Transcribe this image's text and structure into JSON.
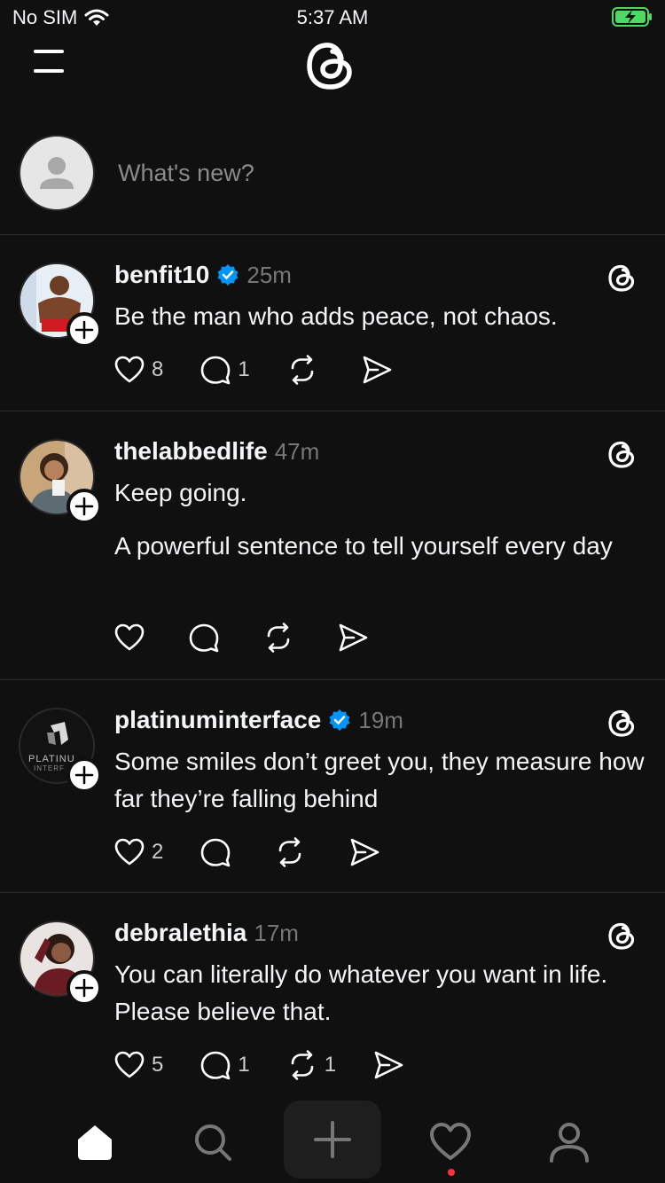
{
  "status_bar": {
    "carrier": "No SIM",
    "time": "5:37 AM",
    "battery_color": "#4cd964"
  },
  "composer": {
    "placeholder": "What's new?"
  },
  "colors": {
    "verified": "#0095f6",
    "notification_dot": "#ff3040",
    "accent_text": "#f3f5f7",
    "muted": "#777777"
  },
  "posts": [
    {
      "username": "benfit10",
      "verified": true,
      "time": "25m",
      "text": "Be the man who adds peace, not chaos.",
      "likes": "8",
      "replies": "1",
      "reposts": "",
      "avatar_icon": "person-photo"
    },
    {
      "username": "thelabbedlife",
      "verified": false,
      "time": "47m",
      "text": "Keep going.",
      "text2": "A powerful sentence to tell yourself every day",
      "likes": "",
      "replies": "",
      "reposts": "",
      "avatar_icon": "person-photo"
    },
    {
      "username": "platinuminterface",
      "verified": true,
      "time": "19m",
      "text": "Some smiles don’t greet you, they measure how far they’re falling behind",
      "likes": "2",
      "replies": "",
      "reposts": "",
      "avatar_icon": "platinum-logo",
      "avatar_text": "PLATINU",
      "avatar_text2": "INTERF"
    },
    {
      "username": "debralethia",
      "verified": false,
      "time": "17m",
      "text": "You can literally do whatever you want in life. Please believe that.",
      "likes": "5",
      "replies": "1",
      "reposts": "1",
      "avatar_icon": "person-photo"
    }
  ],
  "tabs": [
    "home-icon",
    "search-icon",
    "create-icon",
    "activity-icon",
    "profile-icon"
  ]
}
